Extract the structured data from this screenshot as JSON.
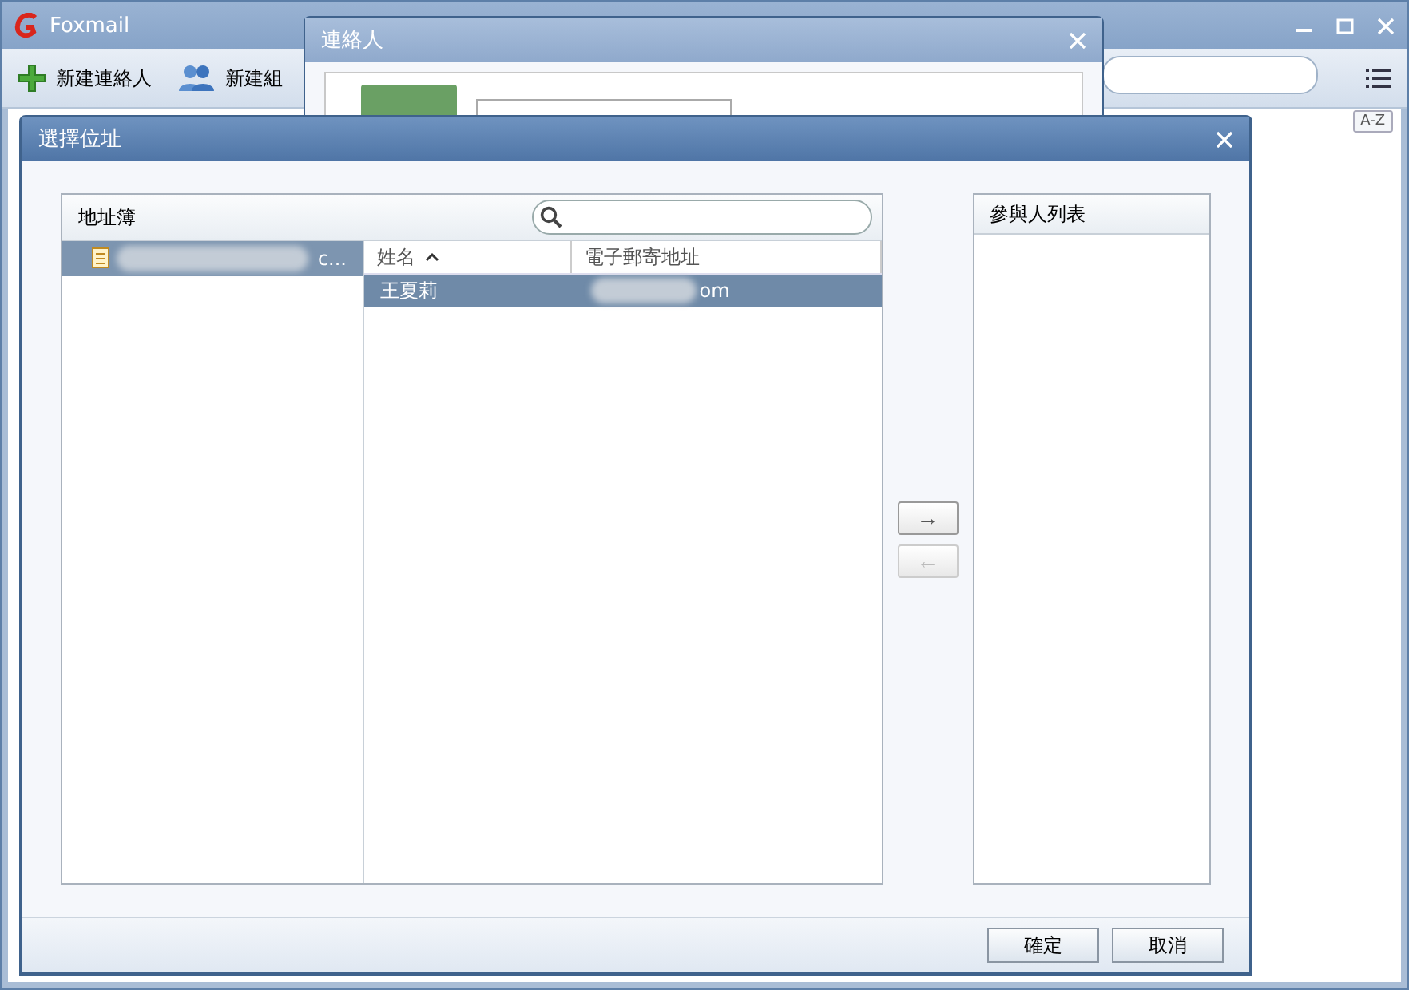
{
  "main_window": {
    "title": "Foxmail",
    "toolbar": [
      {
        "label": "新建連絡人",
        "kind": "add"
      },
      {
        "label": "新建組",
        "kind": "group"
      }
    ],
    "sort_button": "A-Z"
  },
  "contacts_dialog": {
    "title": "連絡人"
  },
  "select_dialog": {
    "title": "選擇位址",
    "address_book": {
      "title": "地址簿",
      "tree": [
        {
          "label": "c...",
          "selected": true
        }
      ]
    },
    "table": {
      "columns": [
        {
          "label": "姓名",
          "sorted": true
        },
        {
          "label": "電子郵寄地址",
          "sorted": false
        }
      ],
      "rows": [
        {
          "name": "王夏莉",
          "email": "om",
          "selected": true
        }
      ]
    },
    "add_button": {
      "label": "→",
      "disabled": false
    },
    "remove_button": {
      "label": "←",
      "disabled": true
    },
    "participants": {
      "title": "參與人列表"
    },
    "buttons": [
      "確定",
      "取消"
    ]
  }
}
